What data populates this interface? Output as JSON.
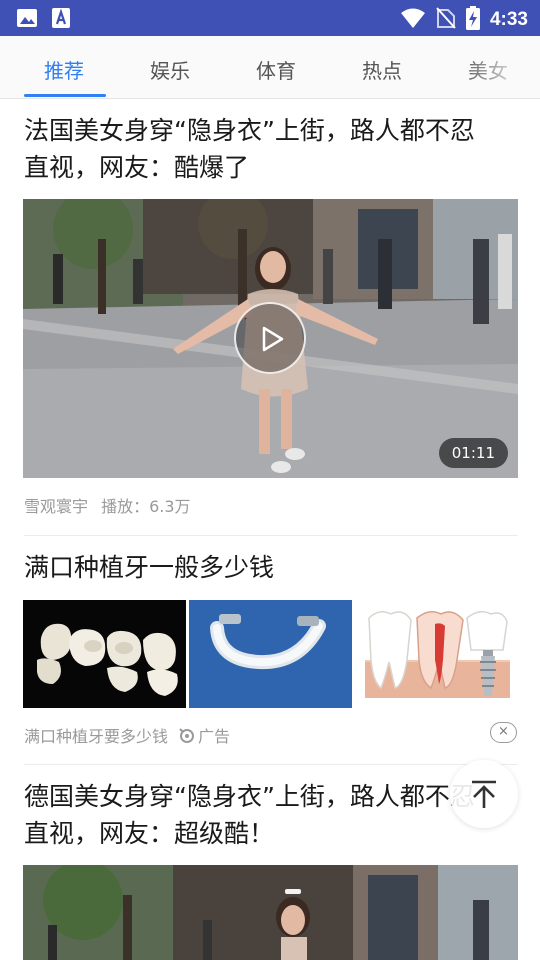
{
  "status_bar": {
    "time": "4:33",
    "left_icons": [
      "image-icon",
      "font-download-icon"
    ],
    "right_icons": [
      "wifi-icon",
      "no-sim-icon",
      "battery-charging-icon"
    ]
  },
  "tabs": [
    {
      "label": "推荐",
      "active": true
    },
    {
      "label": "娱乐",
      "active": false
    },
    {
      "label": "体育",
      "active": false
    },
    {
      "label": "热点",
      "active": false
    },
    {
      "label": "美女",
      "active": false
    }
  ],
  "feed": {
    "item1": {
      "title_line1": "法国美女身穿“隐身衣”上街，路人都不忍",
      "title_line2": "直视，网友：酷爆了",
      "duration": "01:11",
      "author": "雪观寰宇",
      "plays": "播放：6.3万"
    },
    "ad": {
      "title": "满口种植牙一般多少钱",
      "source": "满口种植牙要多少钱",
      "tag": "广告",
      "close_symbol": "×"
    },
    "item2": {
      "title_line1": "德国美女身穿“隐身衣”上街，路人都不忍",
      "title_line2": "直视，网友：超级酷！"
    }
  },
  "colors": {
    "status_bar": "#3f51b5",
    "accent": "#2f7ff5",
    "text_primary": "#1a1a1a",
    "text_meta": "#9a9a9a"
  }
}
